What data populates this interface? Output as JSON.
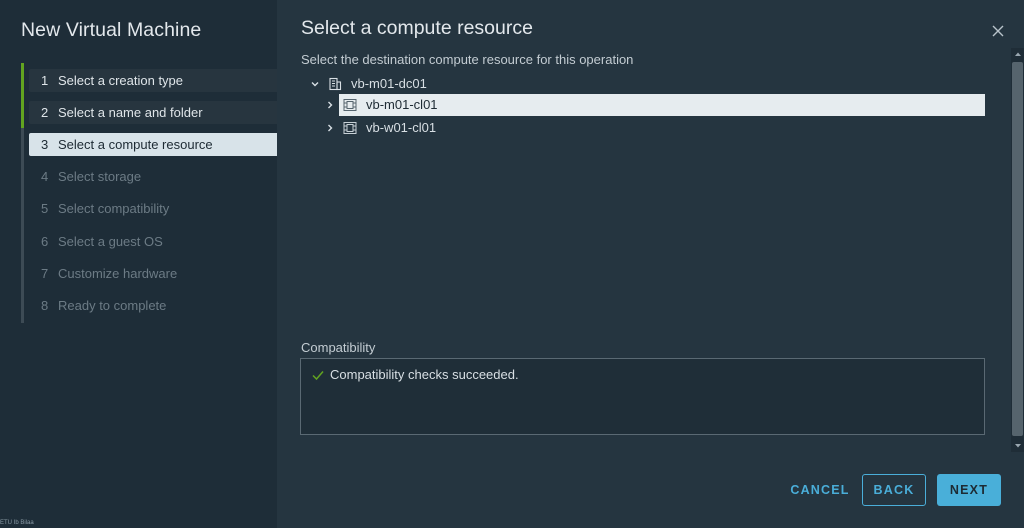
{
  "wizard": {
    "title": "New Virtual Machine",
    "steps": [
      {
        "num": "1",
        "label": "Select a creation type",
        "state": "done"
      },
      {
        "num": "2",
        "label": "Select a name and folder",
        "state": "done"
      },
      {
        "num": "3",
        "label": "Select a compute resource",
        "state": "current"
      },
      {
        "num": "4",
        "label": "Select storage",
        "state": "pending"
      },
      {
        "num": "5",
        "label": "Select compatibility",
        "state": "pending"
      },
      {
        "num": "6",
        "label": "Select a guest OS",
        "state": "pending"
      },
      {
        "num": "7",
        "label": "Customize hardware",
        "state": "pending"
      },
      {
        "num": "8",
        "label": "Ready to complete",
        "state": "pending"
      }
    ],
    "corner_label": "ETU Ib Bilaa"
  },
  "content": {
    "title": "Select a compute resource",
    "instruction": "Select the destination compute resource for this operation",
    "tree": {
      "datacenter": {
        "label": "vb-m01-dc01",
        "icon": "datacenter-icon",
        "expanded": true
      },
      "clusters": [
        {
          "label": "vb-m01-cl01",
          "icon": "cluster-icon",
          "selected": true
        },
        {
          "label": "vb-w01-cl01",
          "icon": "cluster-icon",
          "selected": false
        }
      ]
    },
    "compatibility": {
      "label": "Compatibility",
      "message": "Compatibility checks succeeded."
    }
  },
  "footer": {
    "cancel_label": "CANCEL",
    "back_label": "BACK",
    "next_label": "NEXT"
  },
  "colors": {
    "sidebar_bg": "#1e2d38",
    "content_bg": "#253540",
    "accent_blue": "#49afd9",
    "progress_green": "#62a420",
    "selected_row": "#e6ecef"
  }
}
